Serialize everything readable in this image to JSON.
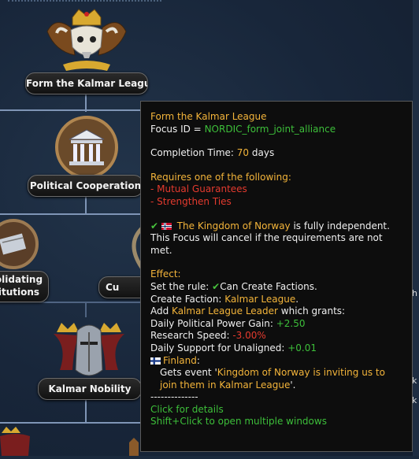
{
  "tree": {
    "nodes": [
      {
        "label": "Form the Kalmar League",
        "icon": "crown-bull-skull-icon"
      },
      {
        "label": "Political Cooperation",
        "icon": "parliament-building-icon"
      },
      {
        "label": "olidating",
        "label2": "itutions",
        "icon": "paper-document-icon"
      },
      {
        "label": "Cu",
        "icon": "unknown-icon"
      },
      {
        "label": "Kalmar Nobility",
        "icon": "knight-helmet-crowns-icon"
      }
    ],
    "right_edge_texts": [
      "h",
      "k",
      "k"
    ]
  },
  "tooltip": {
    "title": "Form the Kalmar League",
    "focus_id_label": "Focus ID = ",
    "focus_id": "NORDIC_form_joint_alliance",
    "completion_label": "Completion Time: ",
    "completion_value": "70",
    "completion_unit": " days",
    "requires_header": "Requires one of the following:",
    "requires": [
      "- Mutual Guarantees",
      "- Strengthen Ties"
    ],
    "independence_subject": "The Kingdom of Norway",
    "independence_suffix": " is fully independent.",
    "cancel_line1": "This Focus will cancel if the requirements are not",
    "cancel_line2": "met.",
    "effect_header": "Effect:",
    "set_rule_prefix": "Set the rule: ",
    "set_rule_value": "Can Create Factions.",
    "create_faction_prefix": "Create Faction: ",
    "create_faction_value": "Kalmar League",
    "create_faction_suffix": ".",
    "add_prefix": "Add ",
    "add_value": "Kalmar League Leader",
    "add_suffix": " which grants:",
    "modifiers": [
      {
        "label": "Daily Political Power Gain: ",
        "value": "+2.50",
        "color": "#3dbf3a"
      },
      {
        "label": "Research Speed: ",
        "value": "-3.00%",
        "color": "#e43a2e"
      },
      {
        "label": "Daily Support for Unaligned: ",
        "value": "+0.01",
        "color": "#3dbf3a"
      }
    ],
    "country": "Finland",
    "country_suffix": ":",
    "event_prefix": "Gets event '",
    "event_name_1": "Kingdom of Norway is inviting us to",
    "event_name_2": "join them in Kalmar League",
    "event_suffix": "'.",
    "separator": "--------------",
    "click_hint": "Click for details",
    "shift_hint": "Shift+Click to open multiple windows"
  },
  "colors": {
    "header_yellow": "#f3b43a",
    "positive_green": "#3dbf3a",
    "negative_red": "#e43a2e"
  }
}
